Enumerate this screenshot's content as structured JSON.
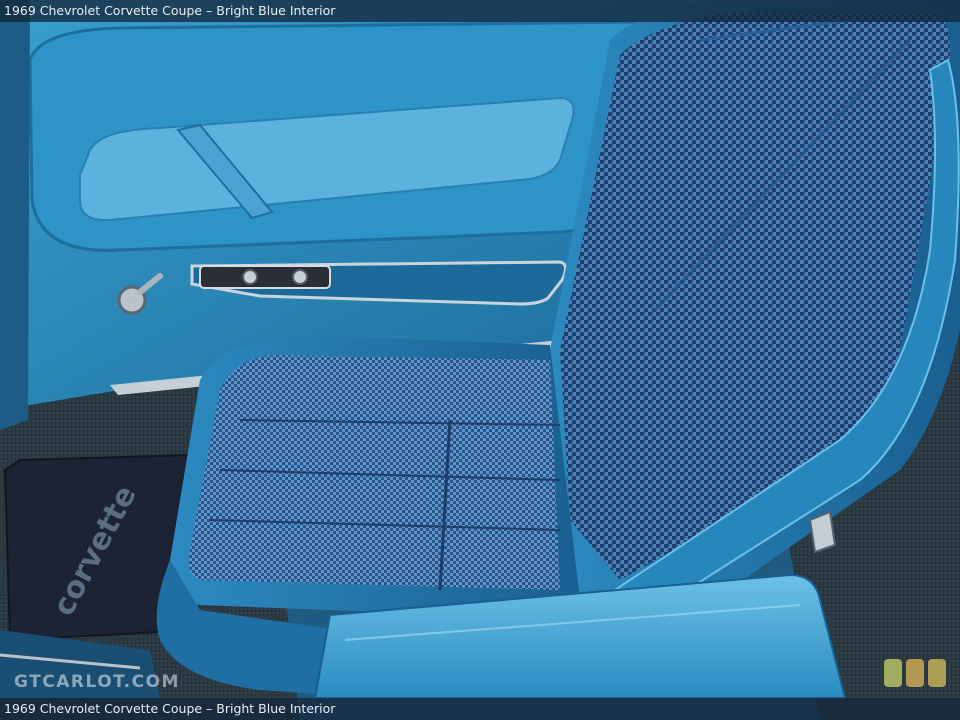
{
  "caption": {
    "top": "1969 Chevrolet Corvette Coupe – Bright Blue Interior",
    "bottom": "1969 Chevrolet Corvette Coupe – Bright Blue Interior"
  },
  "watermark": "GTCARLOT.COM",
  "floor_mat_text": "corvette",
  "colors": {
    "vinyl": "#2f8fc2",
    "vinyl_dark": "#1a5e8a",
    "houndstooth": "#3a6fa8",
    "carpet": "#26313a"
  }
}
